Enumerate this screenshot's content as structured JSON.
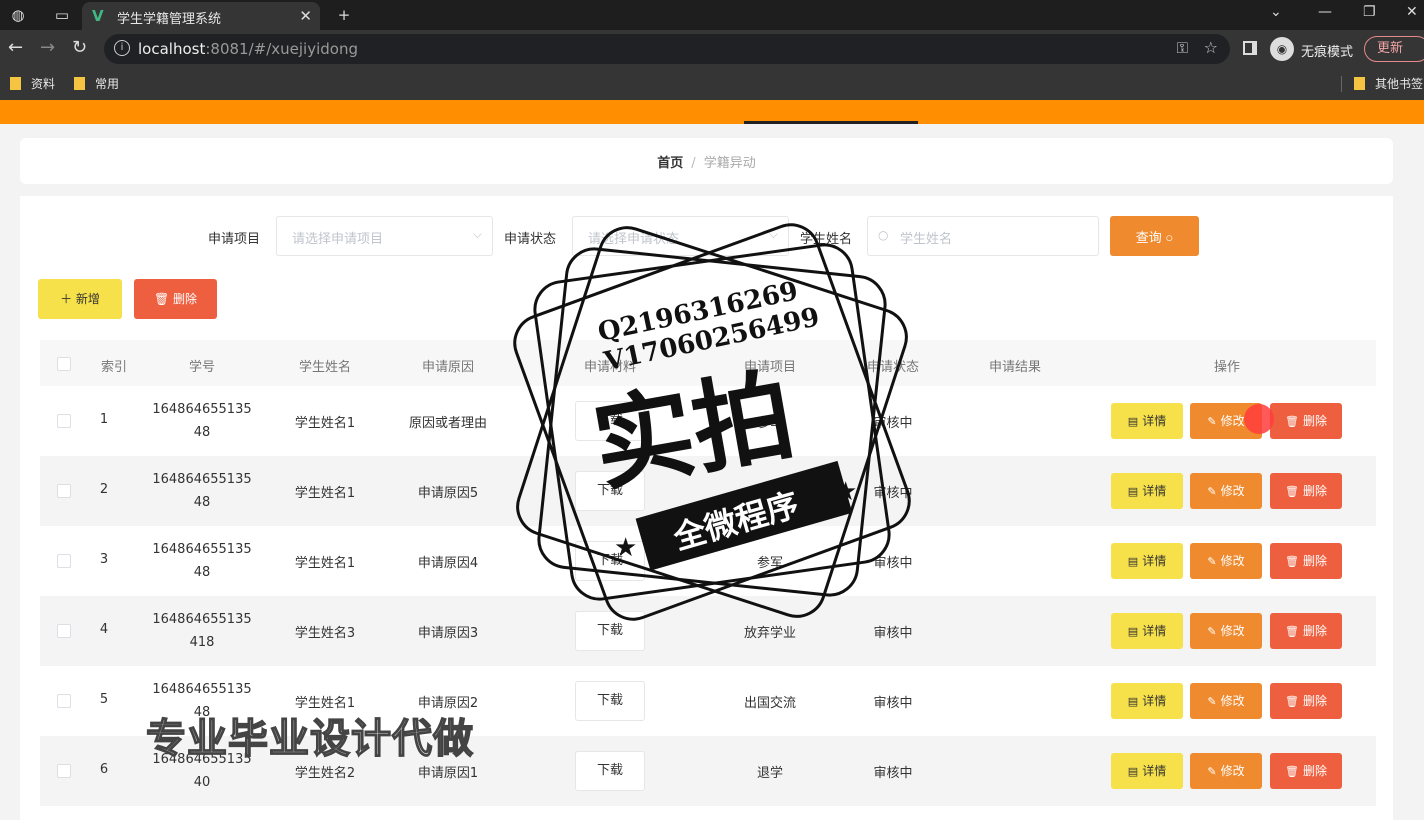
{
  "browser": {
    "tab_title": "学生学籍管理系统",
    "url_host": "localhost",
    "url_rest": ":8081/#/xuejiyidong",
    "incognito_label": "无痕模式",
    "update_label": "更新",
    "bookmarks": [
      "资料",
      "常用"
    ],
    "other_bookmarks": "其他书签"
  },
  "breadcrumb": {
    "home": "首页",
    "separator": "/",
    "current": "学籍异动"
  },
  "filters": {
    "project_label": "申请项目",
    "project_placeholder": "请选择申请项目",
    "status_label": "申请状态",
    "status_placeholder": "请选择申请状态",
    "name_label": "学生姓名",
    "name_placeholder": "学生姓名",
    "query_label": "查询"
  },
  "toolbar": {
    "add_label": "新增",
    "delete_label": "删除"
  },
  "table": {
    "headers": {
      "index": "索引",
      "student_id": "学号",
      "student_name": "学生姓名",
      "reason": "申请原因",
      "attachment": "申请材料",
      "project": "申请项目",
      "status": "申请状态",
      "result": "申请结果",
      "actions": "操作"
    },
    "download_label": "下载",
    "detail_label": "详情",
    "edit_label": "修改",
    "delete_label": "删除",
    "rows": [
      {
        "index": "1",
        "id_line1": "164864655135",
        "id_line2": "48",
        "name": "学生姓名1",
        "reason": "原因或者理由",
        "project": "参军",
        "status": "审核中",
        "result": ""
      },
      {
        "index": "2",
        "id_line1": "164864655135",
        "id_line2": "48",
        "name": "学生姓名1",
        "reason": "申请原因5",
        "project": "",
        "status": "审核中",
        "result": ""
      },
      {
        "index": "3",
        "id_line1": "164864655135",
        "id_line2": "48",
        "name": "学生姓名1",
        "reason": "申请原因4",
        "project": "参军",
        "status": "审核中",
        "result": ""
      },
      {
        "index": "4",
        "id_line1": "164864655135",
        "id_line2": "418",
        "name": "学生姓名3",
        "reason": "申请原因3",
        "project": "放弃学业",
        "status": "审核中",
        "result": ""
      },
      {
        "index": "5",
        "id_line1": "164864655135",
        "id_line2": "48",
        "name": "学生姓名1",
        "reason": "申请原因2",
        "project": "出国交流",
        "status": "审核中",
        "result": ""
      },
      {
        "index": "6",
        "id_line1": "164864655135",
        "id_line2": "40",
        "name": "学生姓名2",
        "reason": "申请原因1",
        "project": "退学",
        "status": "审核中",
        "result": ""
      }
    ]
  },
  "overlay": {
    "qq": "Q2196316269",
    "vx": "V17060256499",
    "big": "实拍",
    "ribbon": "全微程序",
    "bottom_watermark": "专业毕业设计代做"
  }
}
